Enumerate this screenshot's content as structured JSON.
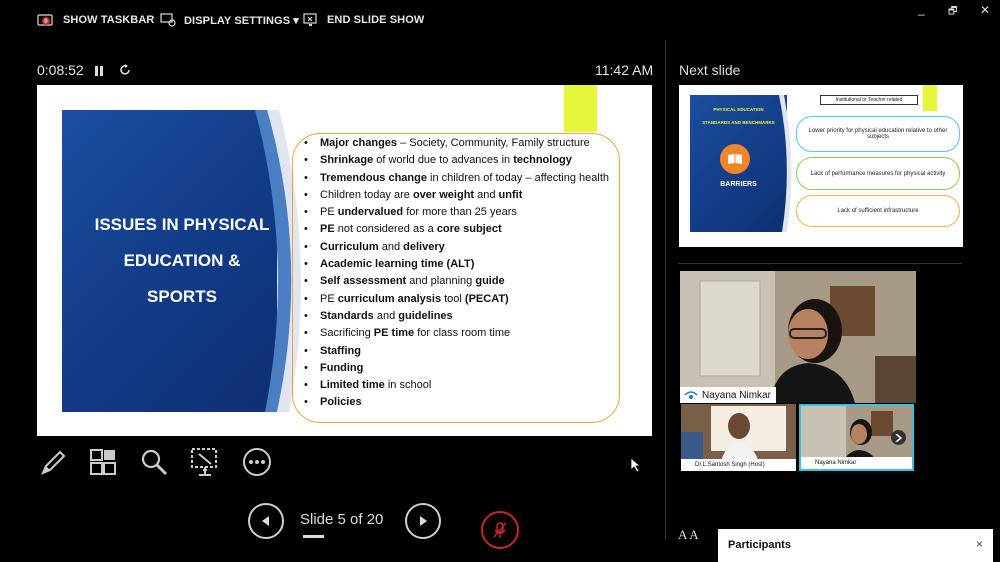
{
  "toolbar": {
    "show_taskbar": "SHOW TASKBAR",
    "display_settings": "DISPLAY SETTINGS ▾",
    "end_slide_show": "END SLIDE SHOW",
    "icons": [
      "taskbar-icon",
      "display-settings-icon",
      "end-show-icon"
    ]
  },
  "window_controls": {
    "minimize": "_",
    "restore": "🗗",
    "close": "✕"
  },
  "timer": {
    "elapsed": "0:08:52",
    "clock": "11:42 AM"
  },
  "slide": {
    "title_lines": [
      "ISSUES IN PHYSICAL",
      "EDUCATION &",
      "SPORTS"
    ],
    "bullets": [
      [
        {
          "t": "Major changes",
          "b": true
        },
        {
          "t": " – Society, Community, Family structure",
          "b": false
        }
      ],
      [
        {
          "t": "Shrinkage",
          "b": true
        },
        {
          "t": " of world due to advances in ",
          "b": false
        },
        {
          "t": "technology",
          "b": true
        }
      ],
      [
        {
          "t": "Tremendous change",
          "b": true
        },
        {
          "t": " in children of today – affecting health",
          "b": false
        }
      ],
      [
        {
          "t": "Children today are ",
          "b": false
        },
        {
          "t": "over weight",
          "b": true
        },
        {
          "t": " and ",
          "b": false
        },
        {
          "t": "unfit",
          "b": true
        }
      ],
      [
        {
          "t": "PE ",
          "b": false
        },
        {
          "t": "undervalued",
          "b": true
        },
        {
          "t": " for more than 25 years",
          "b": false
        }
      ],
      [
        {
          "t": "PE",
          "b": true
        },
        {
          "t": " not considered as a ",
          "b": false
        },
        {
          "t": "core subject",
          "b": true
        }
      ],
      [
        {
          "t": "Curriculum",
          "b": true
        },
        {
          "t": " and ",
          "b": false
        },
        {
          "t": "delivery",
          "b": true
        }
      ],
      [
        {
          "t": "Academic learning time (ALT)",
          "b": true
        }
      ],
      [
        {
          "t": "Self assessment",
          "b": true
        },
        {
          "t": " and planning ",
          "b": false
        },
        {
          "t": "guide",
          "b": true
        }
      ],
      [
        {
          "t": "PE ",
          "b": false
        },
        {
          "t": "curriculum analysis",
          "b": true
        },
        {
          "t": " tool ",
          "b": false
        },
        {
          "t": "(PECAT)",
          "b": true
        }
      ],
      [
        {
          "t": "Standards",
          "b": true
        },
        {
          "t": " and ",
          "b": false
        },
        {
          "t": "guidelines",
          "b": true
        }
      ],
      [
        {
          "t": "Sacrificing ",
          "b": false
        },
        {
          "t": "PE time",
          "b": true
        },
        {
          "t": " for class room time",
          "b": false
        }
      ],
      [
        {
          "t": "Staffing",
          "b": true
        }
      ],
      [
        {
          "t": "Funding",
          "b": true
        }
      ],
      [
        {
          "t": "Limited time",
          "b": true
        },
        {
          "t": " in school",
          "b": false
        }
      ],
      [
        {
          "t": "Policies",
          "b": true
        }
      ]
    ]
  },
  "tools": [
    "pen-icon",
    "see-all-slides-icon",
    "zoom-icon",
    "pointer-options-icon",
    "more-options-icon"
  ],
  "navigation": {
    "counter": "Slide 5 of 20"
  },
  "next_slide": {
    "label": "Next slide",
    "left_title_1": "PHYSICAL EDUCATION",
    "left_title_2": "STANDARDS AND BENCHMARKS",
    "left_heading": "BARRIERS",
    "box_label": "Institutional or Teacher related",
    "ovals": [
      "Lower priority for physical education relative to other subjects",
      "Lack of performance measures for physical activity",
      "Lack of sufficient infrastructure"
    ]
  },
  "video": {
    "main_name": "Nayana Nimkar",
    "tiles": [
      {
        "name": "Dr.L.Santosh Singh (Host)"
      },
      {
        "name": "Nayana Nimkar"
      }
    ]
  },
  "participants": {
    "title": "Participants",
    "close": "×"
  },
  "font_controls": "A  A",
  "colors": {
    "accent_orange": "#f2a03c",
    "slide_blue": "#123a86",
    "highlight_yellow": "#e6f53a",
    "mute_red": "#c8282a"
  }
}
